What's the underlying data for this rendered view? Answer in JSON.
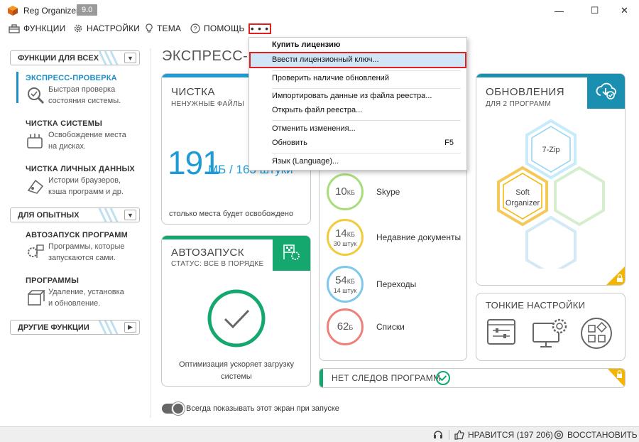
{
  "app": {
    "title": "Reg Organizer",
    "version": "9.0"
  },
  "window": {
    "minimize": "—",
    "maximize": "☐",
    "close": "✕"
  },
  "menu": {
    "functions": "ФУНКЦИИ",
    "settings": "НАСТРОЙКИ",
    "theme": "ТЕМА",
    "help": "ПОМОЩЬ",
    "more": "• • •"
  },
  "sidebar": {
    "group1": "ФУНКЦИИ ДЛЯ ВСЕХ",
    "group2": "ДЛЯ ОПЫТНЫХ",
    "group3": "ДРУГИЕ ФУНКЦИИ",
    "items": [
      {
        "title": "ЭКСПРЕСС-ПРОВЕРКА",
        "desc1": "Быстрая проверка",
        "desc2": "состояния системы."
      },
      {
        "title": "ЧИСТКА СИСТЕМЫ",
        "desc1": "Освобождение места",
        "desc2": "на дисках."
      },
      {
        "title": "ЧИСТКА ЛИЧНЫХ ДАННЫХ",
        "desc1": "Истории браузеров,",
        "desc2": "кэша программ и др."
      },
      {
        "title": "АВТОЗАПУСК ПРОГРАММ",
        "desc1": "Программы, которые",
        "desc2": "запускаются сами."
      },
      {
        "title": "ПРОГРАММЫ",
        "desc1": "Удаление, установка",
        "desc2": "и обновление."
      }
    ]
  },
  "main": {
    "title": "ЭКСПРЕСС-ПРОВЕРКА",
    "cleaning": {
      "title": "ЧИСТКА",
      "subtitle": "НЕНУЖНЫЕ ФАЙЛЫ",
      "number": "191",
      "unit": "МБ / 163 штуки",
      "note": "столько места будет освобождено"
    },
    "autorun": {
      "title": "АВТОЗАПУСК",
      "status": "СТАТУС: ВСЕ В ПОРЯДКЕ",
      "note1": "Оптимизация ускоряет загрузку",
      "note2": "системы"
    },
    "privacy_items": [
      {
        "value": "10",
        "unit": "КБ",
        "sub": "",
        "label": "Skype"
      },
      {
        "value": "14",
        "unit": "КБ",
        "sub": "30 штук",
        "label": "Недавние документы"
      },
      {
        "value": "54",
        "unit": "КБ",
        "sub": "14 штук",
        "label": "Переходы"
      },
      {
        "value": "62",
        "unit": "Б",
        "sub": "",
        "label": "Списки"
      }
    ],
    "updates": {
      "title": "ОБНОВЛЕНИЯ",
      "subtitle": "ДЛЯ 2 ПРОГРАММ",
      "hex1": "7-Zip",
      "hex2a": "Soft",
      "hex2b": "Organizer"
    },
    "tweaks": {
      "title": "ТОНКИЕ НАСТРОЙКИ"
    },
    "no_traces": {
      "title": "НЕТ СЛЕДОВ ПРОГРАММ"
    },
    "show_on_start": "Всегда показывать этот экран при запуске"
  },
  "dropdown": {
    "buy": "Купить лицензию",
    "enter_key": "Ввести лицензионный ключ...",
    "check_updates": "Проверить наличие обновлений",
    "import": "Импортировать данные из файла реестра...",
    "open": "Открыть файл реестра...",
    "undo": "Отменить изменения...",
    "refresh": "Обновить",
    "refresh_key": "F5",
    "language": "Язык (Language)..."
  },
  "statusbar": {
    "like": "НРАВИТСЯ (197 206)",
    "restore": "ВОССТАНОВИТЬ"
  },
  "colors": {
    "accent_blue": "#1e9bd7",
    "green": "#14a86f",
    "teal": "#1a8fb0",
    "yellow": "#f5b400",
    "red": "#e02020"
  }
}
